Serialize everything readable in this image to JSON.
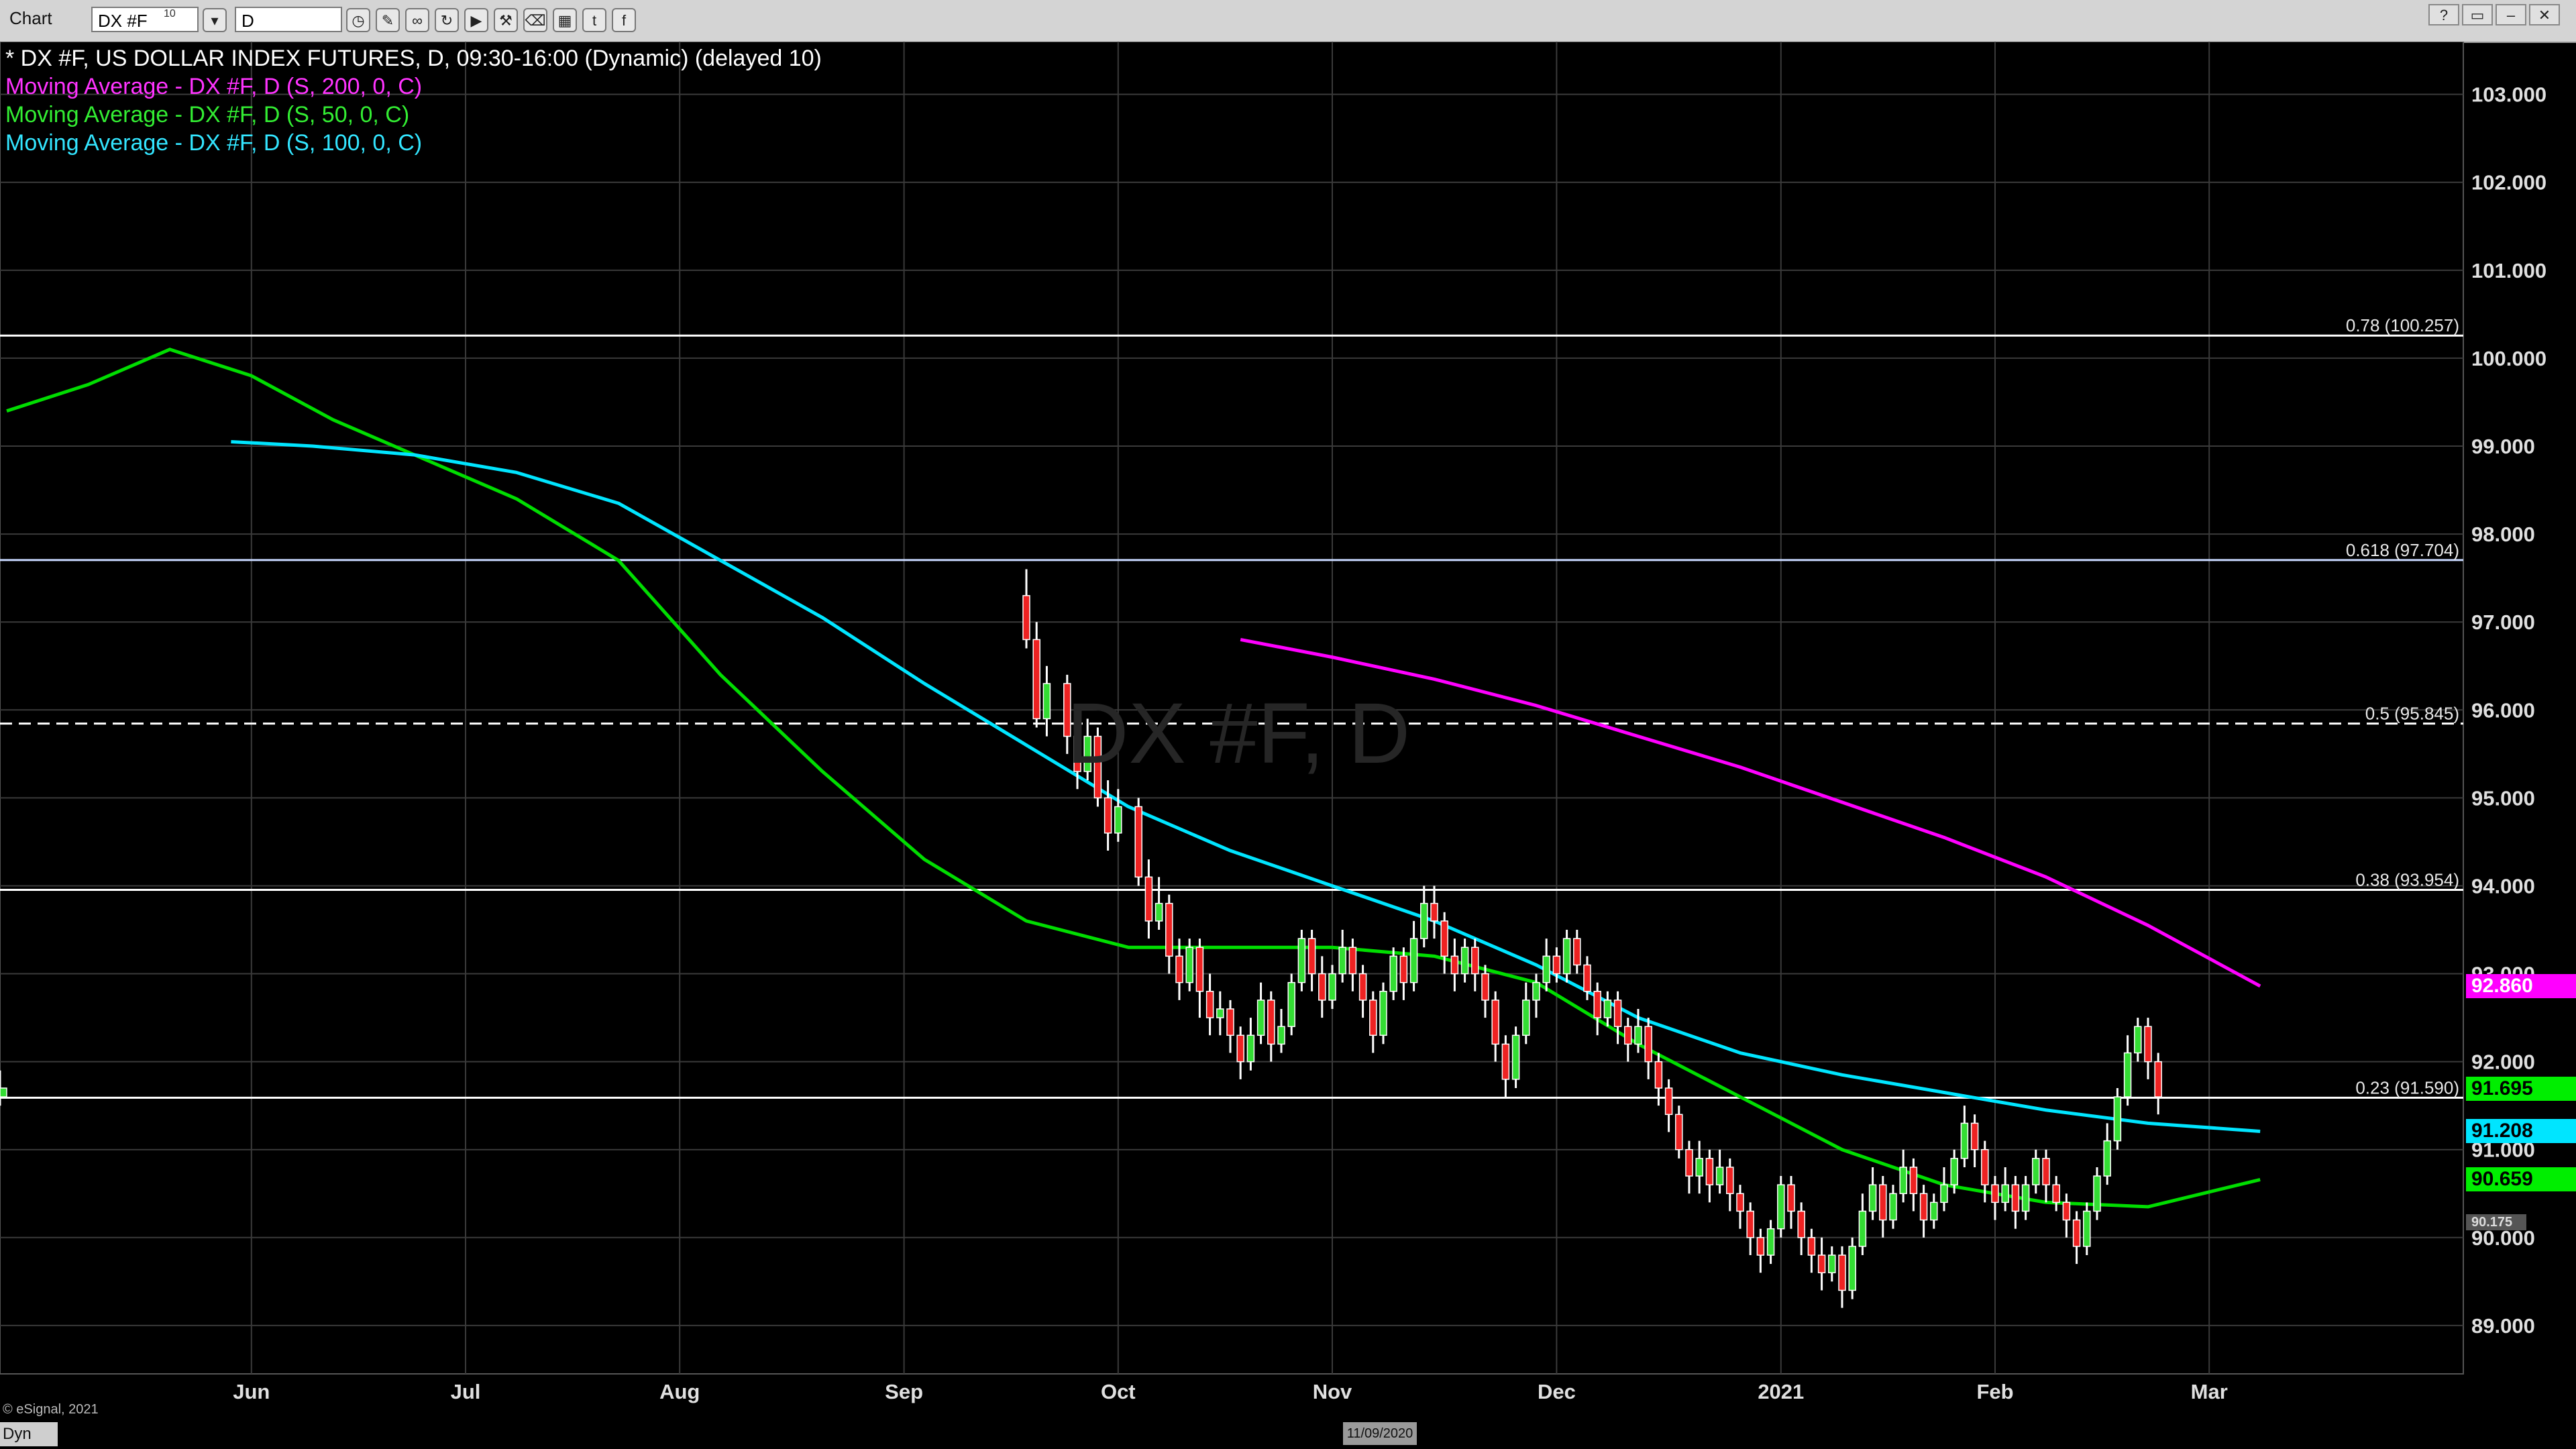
{
  "toolbar": {
    "title": "Chart",
    "symbol": "DX #F",
    "symbol_badge": "10",
    "interval": "D",
    "icons": [
      "clock-icon",
      "pencil-icon",
      "link-icon",
      "refresh-icon",
      "play-icon",
      "tools-icon",
      "eraser-icon",
      "layout-icon",
      "twitter-icon",
      "facebook-icon"
    ]
  },
  "window_controls": [
    "?",
    "▭",
    "–",
    "✕"
  ],
  "legend": {
    "title": "* DX #F, US DOLLAR INDEX FUTURES, D, 09:30-16:00 (Dynamic) (delayed 10)",
    "ma200": "Moving Average - DX #F, D (S, 200, 0, C)",
    "ma50": "Moving Average - DX #F, D (S, 50, 0, C)",
    "ma100": "Moving Average - DX #F, D (S, 100, 0, C)"
  },
  "watermark": "DX #F, D",
  "footer": {
    "copyright": "© eSignal, 2021",
    "mode": "Dyn",
    "date_tag": "11/09/2020"
  },
  "chart_data": {
    "type": "candlestick",
    "title": "* DX #F, US DOLLAR INDEX FUTURES, D, 09:30-16:00 (Dynamic) (delayed 10)",
    "ylim": [
      88.45,
      103.6
    ],
    "y_ticks": [
      "89.000",
      "90.000",
      "91.000",
      "92.000",
      "93.000",
      "94.000",
      "95.000",
      "96.000",
      "97.000",
      "98.000",
      "99.000",
      "100.000",
      "101.000",
      "102.000",
      "103.000"
    ],
    "x_ticks": [
      "Jun",
      "Jul",
      "Aug",
      "Sep",
      "Oct",
      "Nov",
      "Dec",
      "2021",
      "Feb",
      "Mar"
    ],
    "x_tick_days": [
      24,
      45,
      66,
      88,
      109,
      130,
      152,
      174,
      195,
      216
    ],
    "candles": [
      [
        97.3,
        96.8,
        97.6,
        96.7
      ],
      [
        96.8,
        95.9,
        97.0,
        95.8
      ],
      [
        95.9,
        96.3,
        96.5,
        95.7
      ],
      [
        96.3,
        95.7,
        96.4,
        95.5
      ],
      [
        95.7,
        95.3,
        95.9,
        95.1
      ],
      [
        95.3,
        95.7,
        95.9,
        95.2
      ],
      [
        95.7,
        95.0,
        95.8,
        94.9
      ],
      [
        95.0,
        94.6,
        95.2,
        94.4
      ],
      [
        94.6,
        94.9,
        95.1,
        94.5
      ],
      [
        94.9,
        94.1,
        95.0,
        94.0
      ],
      [
        94.1,
        93.6,
        94.3,
        93.4
      ],
      [
        93.6,
        93.8,
        94.1,
        93.5
      ],
      [
        93.8,
        93.2,
        93.9,
        93.0
      ],
      [
        93.2,
        92.9,
        93.4,
        92.7
      ],
      [
        92.9,
        93.3,
        93.4,
        92.8
      ],
      [
        93.3,
        92.8,
        93.4,
        92.5
      ],
      [
        92.8,
        92.5,
        93.0,
        92.3
      ],
      [
        92.5,
        92.6,
        92.8,
        92.3
      ],
      [
        92.6,
        92.3,
        92.7,
        92.1
      ],
      [
        92.3,
        92.0,
        92.4,
        91.8
      ],
      [
        92.0,
        92.3,
        92.5,
        91.9
      ],
      [
        92.3,
        92.7,
        92.9,
        92.2
      ],
      [
        92.7,
        92.2,
        92.8,
        92.0
      ],
      [
        92.2,
        92.4,
        92.6,
        92.1
      ],
      [
        92.4,
        92.9,
        93.0,
        92.3
      ],
      [
        92.9,
        93.4,
        93.5,
        92.8
      ],
      [
        93.4,
        93.0,
        93.5,
        92.8
      ],
      [
        93.0,
        92.7,
        93.2,
        92.5
      ],
      [
        92.7,
        93.0,
        93.1,
        92.6
      ],
      [
        93.0,
        93.3,
        93.5,
        92.9
      ],
      [
        93.3,
        93.0,
        93.4,
        92.8
      ],
      [
        93.0,
        92.7,
        93.1,
        92.5
      ],
      [
        92.7,
        92.3,
        92.8,
        92.1
      ],
      [
        92.3,
        92.8,
        92.9,
        92.2
      ],
      [
        92.8,
        93.2,
        93.3,
        92.7
      ],
      [
        93.2,
        92.9,
        93.3,
        92.7
      ],
      [
        92.9,
        93.4,
        93.6,
        92.8
      ],
      [
        93.4,
        93.8,
        94.0,
        93.3
      ],
      [
        93.8,
        93.6,
        94.0,
        93.4
      ],
      [
        93.6,
        93.2,
        93.7,
        93.0
      ],
      [
        93.2,
        93.0,
        93.4,
        92.8
      ],
      [
        93.0,
        93.3,
        93.4,
        92.9
      ],
      [
        93.3,
        93.0,
        93.4,
        92.8
      ],
      [
        93.0,
        92.7,
        93.1,
        92.5
      ],
      [
        92.7,
        92.2,
        92.8,
        92.0
      ],
      [
        92.2,
        91.8,
        92.3,
        91.6
      ],
      [
        91.8,
        92.3,
        92.4,
        91.7
      ],
      [
        92.3,
        92.7,
        92.9,
        92.2
      ],
      [
        92.7,
        92.9,
        93.0,
        92.5
      ],
      [
        92.9,
        93.2,
        93.4,
        92.8
      ],
      [
        93.2,
        93.0,
        93.3,
        92.9
      ],
      [
        93.0,
        93.4,
        93.5,
        92.9
      ],
      [
        93.4,
        93.1,
        93.5,
        93.0
      ],
      [
        93.1,
        92.8,
        93.2,
        92.7
      ],
      [
        92.8,
        92.5,
        92.9,
        92.3
      ],
      [
        92.5,
        92.7,
        92.8,
        92.4
      ],
      [
        92.7,
        92.4,
        92.8,
        92.2
      ],
      [
        92.4,
        92.2,
        92.5,
        92.0
      ],
      [
        92.2,
        92.4,
        92.6,
        92.1
      ],
      [
        92.4,
        92.0,
        92.5,
        91.8
      ],
      [
        92.0,
        91.7,
        92.1,
        91.5
      ],
      [
        91.7,
        91.4,
        91.8,
        91.2
      ],
      [
        91.4,
        91.0,
        91.5,
        90.9
      ],
      [
        91.0,
        90.7,
        91.1,
        90.5
      ],
      [
        90.7,
        90.9,
        91.1,
        90.5
      ],
      [
        90.9,
        90.6,
        91.0,
        90.4
      ],
      [
        90.6,
        90.8,
        91.0,
        90.5
      ],
      [
        90.8,
        90.5,
        90.9,
        90.3
      ],
      [
        90.5,
        90.3,
        90.6,
        90.1
      ],
      [
        90.3,
        90.0,
        90.4,
        89.8
      ],
      [
        90.0,
        89.8,
        90.1,
        89.6
      ],
      [
        89.8,
        90.1,
        90.2,
        89.7
      ],
      [
        90.1,
        90.6,
        90.7,
        90.0
      ],
      [
        90.6,
        90.3,
        90.7,
        90.1
      ],
      [
        90.3,
        90.0,
        90.4,
        89.8
      ],
      [
        90.0,
        89.8,
        90.1,
        89.6
      ],
      [
        89.8,
        89.6,
        90.0,
        89.4
      ],
      [
        89.6,
        89.8,
        89.9,
        89.5
      ],
      [
        89.8,
        89.4,
        89.9,
        89.2
      ],
      [
        89.4,
        89.9,
        90.0,
        89.3
      ],
      [
        89.9,
        90.3,
        90.5,
        89.8
      ],
      [
        90.3,
        90.6,
        90.8,
        90.2
      ],
      [
        90.6,
        90.2,
        90.7,
        90.0
      ],
      [
        90.2,
        90.5,
        90.6,
        90.1
      ],
      [
        90.5,
        90.8,
        91.0,
        90.4
      ],
      [
        90.8,
        90.5,
        90.9,
        90.3
      ],
      [
        90.5,
        90.2,
        90.6,
        90.0
      ],
      [
        90.2,
        90.4,
        90.5,
        90.1
      ],
      [
        90.4,
        90.6,
        90.8,
        90.3
      ],
      [
        90.6,
        90.9,
        91.0,
        90.5
      ],
      [
        90.9,
        91.3,
        91.5,
        90.8
      ],
      [
        91.3,
        91.0,
        91.4,
        90.8
      ],
      [
        91.0,
        90.6,
        91.1,
        90.4
      ],
      [
        90.6,
        90.4,
        90.7,
        90.2
      ],
      [
        90.4,
        90.6,
        90.8,
        90.3
      ],
      [
        90.6,
        90.3,
        90.7,
        90.1
      ],
      [
        90.3,
        90.6,
        90.7,
        90.2
      ],
      [
        90.6,
        90.9,
        91.0,
        90.5
      ],
      [
        90.9,
        90.6,
        91.0,
        90.4
      ],
      [
        90.6,
        90.4,
        90.7,
        90.3
      ],
      [
        90.4,
        90.2,
        90.5,
        90.0
      ],
      [
        90.2,
        89.9,
        90.3,
        89.7
      ],
      [
        89.9,
        90.3,
        90.4,
        89.8
      ],
      [
        90.3,
        90.7,
        90.8,
        90.2
      ],
      [
        90.7,
        91.1,
        91.3,
        90.6
      ],
      [
        91.1,
        91.6,
        91.7,
        91.0
      ],
      [
        91.6,
        92.1,
        92.3,
        91.5
      ],
      [
        92.1,
        92.4,
        92.5,
        92.0
      ],
      [
        92.4,
        92.0,
        92.5,
        91.8
      ],
      [
        92.0,
        91.6,
        92.1,
        91.4
      ],
      [
        91.6,
        91.7,
        91.9,
        91.5
      ]
    ],
    "candle_day_start": 0,
    "candle_days": [
      100,
      101,
      102,
      104,
      105,
      106,
      107,
      108,
      109,
      111,
      112,
      113,
      114,
      115,
      116,
      117,
      118,
      119,
      120,
      121,
      122,
      123,
      124,
      125,
      126,
      127,
      128,
      129,
      130,
      131,
      132,
      133,
      134,
      135,
      136,
      137,
      138,
      139,
      140,
      141,
      142,
      143,
      144,
      145,
      146,
      147,
      148,
      149,
      150,
      151,
      152,
      153,
      154,
      155,
      156,
      157,
      158,
      159,
      160,
      161,
      162,
      163,
      164,
      165,
      166,
      167,
      168,
      169,
      170,
      171,
      172,
      173,
      174,
      175,
      176,
      177,
      178,
      179,
      180,
      181,
      182,
      183,
      184,
      185,
      186,
      187,
      188,
      189,
      190,
      191,
      192,
      193,
      194,
      195,
      196,
      197,
      198,
      199,
      200,
      201,
      202,
      203,
      204,
      205,
      206,
      207,
      208,
      209,
      210,
      211
    ],
    "series": [
      {
        "name": "Moving Average - DX #F, D (S, 200, 0, C)",
        "color": "#ff00ff",
        "x": [
          121,
          130,
          140,
          150,
          160,
          170,
          180,
          190,
          200,
          210,
          221
        ],
        "values": [
          96.8,
          96.6,
          96.35,
          96.05,
          95.7,
          95.35,
          94.95,
          94.55,
          94.1,
          93.55,
          92.86
        ]
      },
      {
        "name": "Moving Average - DX #F, D (S, 50, 0, C)",
        "color": "#00dd00",
        "x": [
          0,
          8,
          16,
          24,
          32,
          40,
          50,
          60,
          70,
          80,
          90,
          100,
          110,
          120,
          130,
          140,
          150,
          160,
          170,
          180,
          190,
          200,
          210,
          221
        ],
        "values": [
          99.4,
          99.7,
          100.1,
          99.8,
          99.3,
          98.9,
          98.4,
          97.7,
          96.4,
          95.3,
          94.3,
          93.6,
          93.3,
          93.3,
          93.3,
          93.2,
          92.9,
          92.2,
          91.6,
          91.0,
          90.6,
          90.4,
          90.35,
          90.659
        ]
      },
      {
        "name": "Moving Average - DX #F, D (S, 100, 0, C)",
        "color": "#00e5ff",
        "x": [
          22,
          30,
          40,
          50,
          60,
          70,
          80,
          90,
          100,
          110,
          120,
          130,
          140,
          150,
          160,
          170,
          180,
          190,
          200,
          210,
          221
        ],
        "values": [
          99.05,
          99.0,
          98.9,
          98.7,
          98.35,
          97.7,
          97.05,
          96.3,
          95.6,
          94.9,
          94.4,
          94.0,
          93.6,
          93.1,
          92.5,
          92.1,
          91.85,
          91.65,
          91.45,
          91.3,
          91.208
        ]
      }
    ],
    "fib_levels": [
      {
        "label": "0.78 (100.257)",
        "value": 100.257,
        "style": "solid",
        "color": "#ffffff"
      },
      {
        "label": "0.618 (97.704)",
        "value": 97.704,
        "style": "solid",
        "color": "#c8d8ff"
      },
      {
        "label": "0.5 (95.845)",
        "value": 95.845,
        "style": "dashed",
        "color": "#ffffff"
      },
      {
        "label": "0.38 (93.954)",
        "value": 93.954,
        "style": "solid",
        "color": "#ffffff"
      },
      {
        "label": "0.23 (91.590)",
        "value": 91.59,
        "style": "solid",
        "color": "#ffffff"
      }
    ],
    "price_labels": [
      {
        "text": "92.860",
        "value": 92.86,
        "bg": "#ff00ff",
        "fg": "#ffffff"
      },
      {
        "text": "91.695",
        "value": 91.695,
        "bg": "#00ee00",
        "fg": "#000000"
      },
      {
        "text": "91.208",
        "value": 91.208,
        "bg": "#00e5ff",
        "fg": "#000000"
      },
      {
        "text": "90.659",
        "value": 90.659,
        "bg": "#00ee00",
        "fg": "#000000"
      },
      {
        "text": "90.175",
        "value": 90.175,
        "bg": "#555555",
        "fg": "#dddddd"
      }
    ],
    "up_color": "#33dd33",
    "down_color": "#ee2222",
    "grid": true
  }
}
